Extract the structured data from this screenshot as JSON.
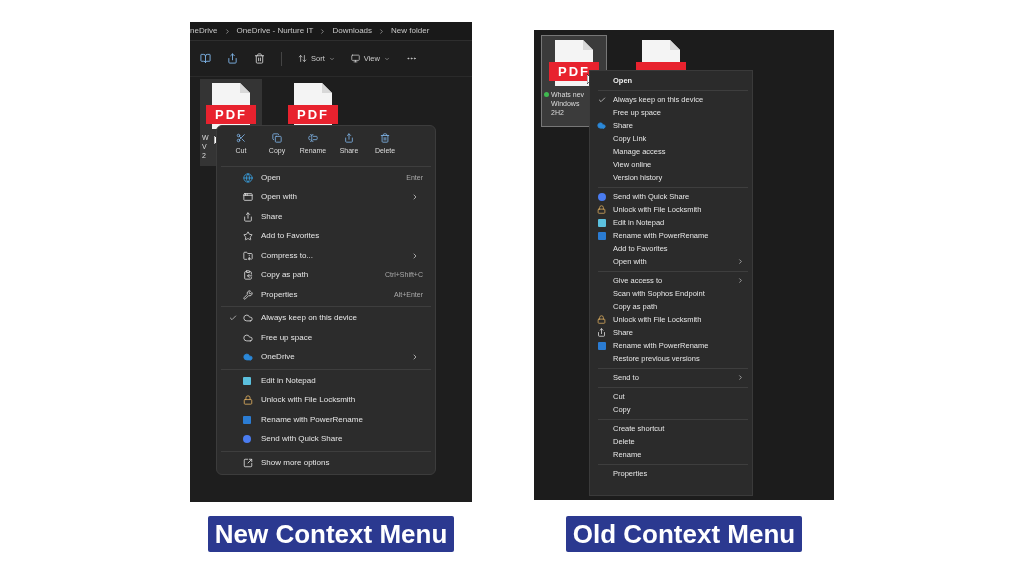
{
  "new_context_menu": {
    "breadcrumb": [
      "neDrive",
      "OneDrive - Nurture IT",
      "Downloads",
      "New folder"
    ],
    "toolbar": {
      "sort": "Sort",
      "view": "View"
    },
    "files": [
      {
        "selected": true,
        "badge": "PDF",
        "label_lines": [
          "W",
          "V",
          "2"
        ]
      },
      {
        "selected": false,
        "badge": "PDF"
      }
    ],
    "quick_actions": [
      {
        "label": "Cut"
      },
      {
        "label": "Copy"
      },
      {
        "label": "Rename"
      },
      {
        "label": "Share"
      },
      {
        "label": "Delete"
      }
    ],
    "groups": [
      [
        {
          "label": "Open",
          "shortcut": "Enter",
          "submenu": false,
          "checked": false
        },
        {
          "label": "Open with",
          "submenu": true,
          "checked": false
        },
        {
          "label": "Share",
          "submenu": false,
          "checked": false
        },
        {
          "label": "Add to Favorites",
          "submenu": false,
          "checked": false
        },
        {
          "label": "Compress to...",
          "submenu": true,
          "checked": false
        },
        {
          "label": "Copy as path",
          "shortcut": "Ctrl+Shift+C",
          "submenu": false,
          "checked": false
        },
        {
          "label": "Properties",
          "shortcut": "Alt+Enter",
          "submenu": false,
          "checked": false
        }
      ],
      [
        {
          "label": "Always keep on this device",
          "submenu": false,
          "checked": true
        },
        {
          "label": "Free up space",
          "submenu": false,
          "checked": false
        },
        {
          "label": "OneDrive",
          "submenu": true,
          "checked": false
        }
      ],
      [
        {
          "label": "Edit in Notepad",
          "submenu": false,
          "checked": false
        },
        {
          "label": "Unlock with File Locksmith",
          "submenu": false,
          "checked": false
        },
        {
          "label": "Rename with PowerRename",
          "submenu": false,
          "checked": false
        },
        {
          "label": "Send with Quick Share",
          "submenu": false,
          "checked": false
        }
      ],
      [
        {
          "label": "Show more options",
          "submenu": false,
          "checked": false
        }
      ]
    ],
    "caption": "New Context Menu"
  },
  "old_context_menu": {
    "files": [
      {
        "selected": true,
        "badge": "PDF",
        "label_lines": [
          "Whats nev",
          "Windows",
          "2H2"
        ]
      },
      {
        "selected": false
      }
    ],
    "default_item": "Open",
    "groups": [
      [
        {
          "label": "Always keep on this device",
          "submenu": false,
          "checked": true
        },
        {
          "label": "Free up space",
          "submenu": false,
          "checked": false
        },
        {
          "label": "Share",
          "submenu": false,
          "checked": false
        },
        {
          "label": "Copy Link",
          "submenu": false,
          "checked": false
        },
        {
          "label": "Manage access",
          "submenu": false,
          "checked": false
        },
        {
          "label": "View online",
          "submenu": false,
          "checked": false
        },
        {
          "label": "Version history",
          "submenu": false,
          "checked": false
        }
      ],
      [
        {
          "label": "Send with Quick Share",
          "submenu": false,
          "checked": false
        },
        {
          "label": "Unlock with File Locksmith",
          "submenu": false,
          "checked": false
        },
        {
          "label": "Edit in Notepad",
          "submenu": false,
          "checked": false
        },
        {
          "label": "Rename with PowerRename",
          "submenu": false,
          "checked": false
        },
        {
          "label": "Add to Favorites",
          "submenu": false,
          "checked": false
        },
        {
          "label": "Open with",
          "submenu": true,
          "checked": false
        }
      ],
      [
        {
          "label": "Give access to",
          "submenu": true,
          "checked": false
        },
        {
          "label": "Scan with Sophos Endpoint",
          "submenu": false,
          "checked": false
        },
        {
          "label": "Copy as path",
          "submenu": false,
          "checked": false
        },
        {
          "label": "Unlock with File Locksmith",
          "submenu": false,
          "checked": false
        },
        {
          "label": "Share",
          "submenu": false,
          "checked": false
        },
        {
          "label": "Rename with PowerRename",
          "submenu": false,
          "checked": false
        },
        {
          "label": "Restore previous versions",
          "submenu": false,
          "checked": false
        }
      ],
      [
        {
          "label": "Send to",
          "submenu": true,
          "checked": false
        }
      ],
      [
        {
          "label": "Cut",
          "submenu": false,
          "checked": false
        },
        {
          "label": "Copy",
          "submenu": false,
          "checked": false
        }
      ],
      [
        {
          "label": "Create shortcut",
          "submenu": false,
          "checked": false
        },
        {
          "label": "Delete",
          "submenu": false,
          "checked": false
        },
        {
          "label": "Rename",
          "submenu": false,
          "checked": false
        }
      ],
      [
        {
          "label": "Properties",
          "submenu": false,
          "checked": false
        }
      ]
    ],
    "caption": "Old Context Menu"
  }
}
